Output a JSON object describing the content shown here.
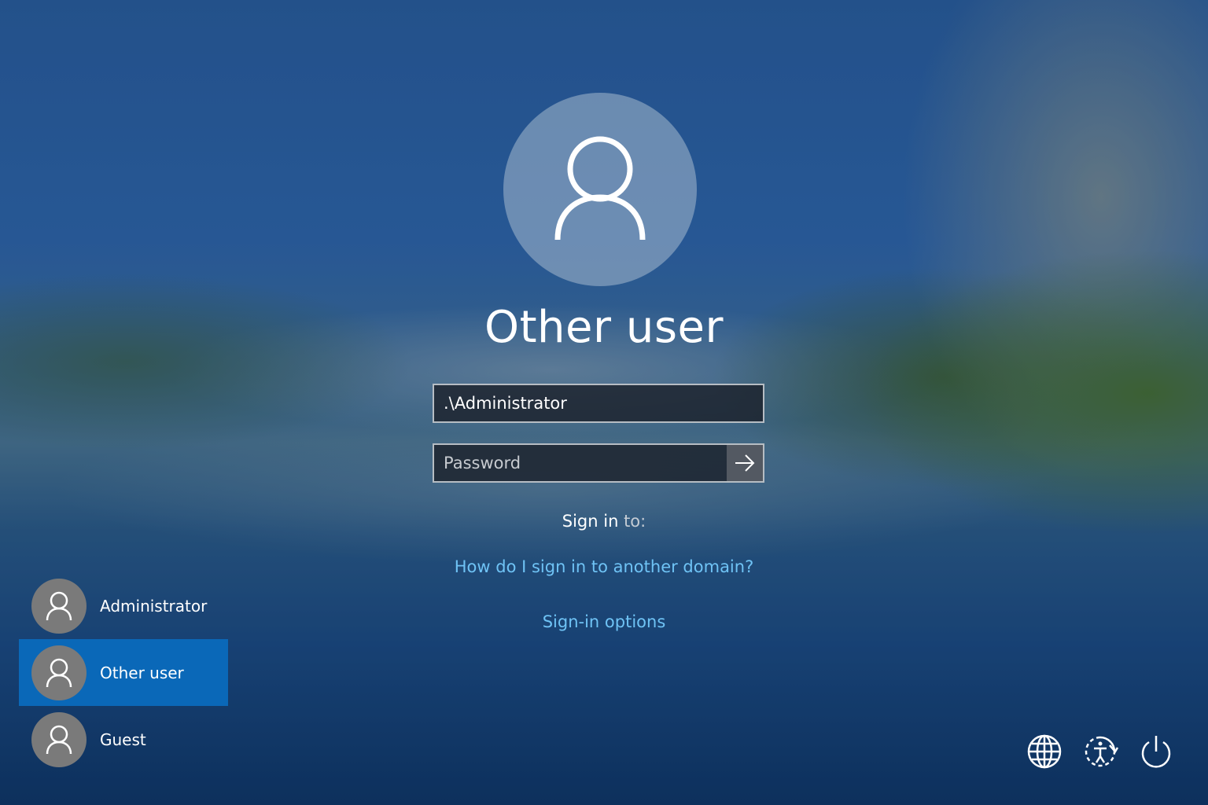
{
  "tile": {
    "title": "Other user"
  },
  "form": {
    "username_value": ".\\Administrator",
    "password_placeholder": "Password",
    "signin_to_label": "Sign in",
    "signin_to_suffix": "to:"
  },
  "links": {
    "domain_help": "How do I sign in to another domain?",
    "signin_options": "Sign-in options"
  },
  "users": [
    {
      "name": "Administrator",
      "selected": false
    },
    {
      "name": "Other user",
      "selected": true
    },
    {
      "name": "Guest",
      "selected": false
    }
  ],
  "system_icons": [
    {
      "icon": "globe-icon",
      "label": "Network"
    },
    {
      "icon": "ease-of-access-icon",
      "label": "Accessibility"
    },
    {
      "icon": "power-icon",
      "label": "Power"
    }
  ],
  "colors": {
    "link": "#6fc3f5",
    "selected_user_bg": "#0a68b8",
    "user_avatar_bg": "#7a7a7a"
  }
}
